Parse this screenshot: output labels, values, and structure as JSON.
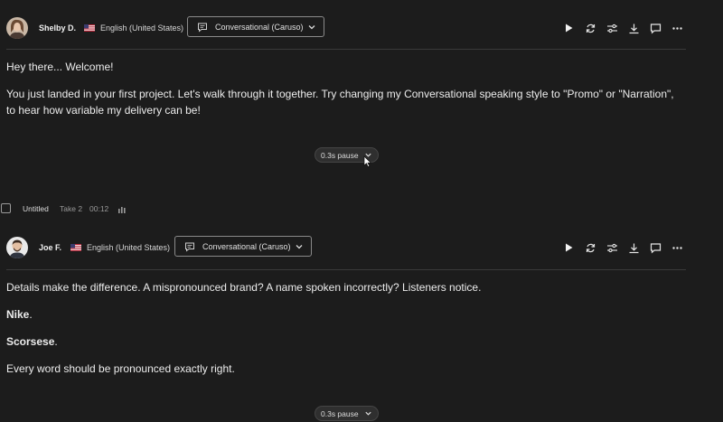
{
  "blocks": [
    {
      "speaker": "Shelby D.",
      "language": "English (United States)",
      "style": "Conversational (Caruso)",
      "paragraphs": [
        "Hey there... Welcome!",
        "You just landed in your first project. Let's walk through it together. Try changing my Conversational speaking style to \"Promo\" or \"Narration\", to hear how variable my delivery can be!"
      ],
      "pause": "0.3s pause"
    },
    {
      "speaker": "Joe F.",
      "language": "English (United States)",
      "style": "Conversational (Caruso)",
      "paragraphs": [
        "Details make the difference. A mispronounced brand? A name spoken incorrectly? Listeners notice.",
        "Nike",
        ".",
        "Scorsese",
        ".",
        "Every word should be pronounced exactly right."
      ],
      "pause": "0.3s pause"
    }
  ],
  "take": {
    "title": "Untitled",
    "take": "Take 2",
    "duration": "00:12"
  },
  "icons": [
    "play-icon",
    "repeat-icon",
    "sliders-icon",
    "download-icon",
    "comment-icon",
    "more-icon",
    "chevron-down-icon",
    "waveform-icon",
    "us-flag-icon",
    "speech-bubble-icon"
  ],
  "colors": {
    "background": "#1c1c1c",
    "text": "#ececec",
    "divider": "#3a3a3a"
  }
}
